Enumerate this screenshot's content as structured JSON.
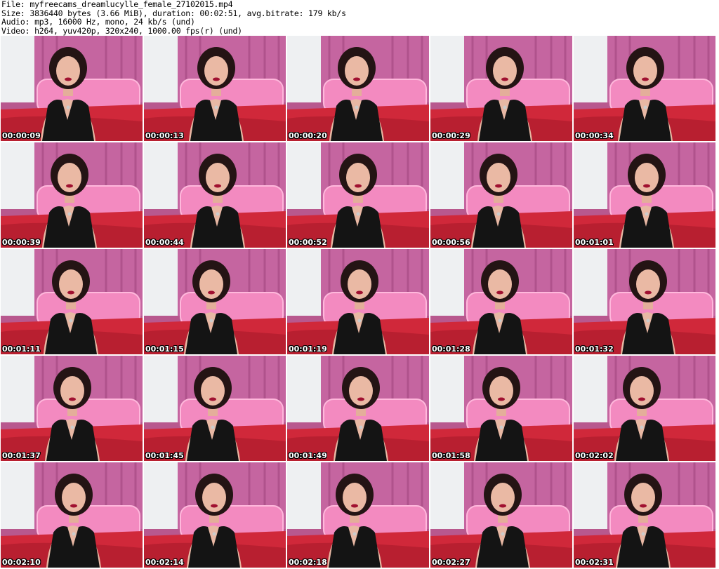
{
  "header": {
    "file_line": "File: myfreecams_dreamlucylle_female_27102015.mp4",
    "size_line": "Size: 3836440 bytes (3.66 MiB), duration: 00:02:51, avg.bitrate: 179 kb/s",
    "audio_line": "Audio: mp3, 16000 Hz, mono, 24 kb/s (und)",
    "video_line": "Video: h264, yuv420p, 320x240, 1000.00 fps(r) (und)"
  },
  "thumbnails": [
    {
      "timestamp": "00:00:09"
    },
    {
      "timestamp": "00:00:13"
    },
    {
      "timestamp": "00:00:20"
    },
    {
      "timestamp": "00:00:29"
    },
    {
      "timestamp": "00:00:34"
    },
    {
      "timestamp": "00:00:39"
    },
    {
      "timestamp": "00:00:44"
    },
    {
      "timestamp": "00:00:52"
    },
    {
      "timestamp": "00:00:56"
    },
    {
      "timestamp": "00:01:01"
    },
    {
      "timestamp": "00:01:11"
    },
    {
      "timestamp": "00:01:15"
    },
    {
      "timestamp": "00:01:19"
    },
    {
      "timestamp": "00:01:28"
    },
    {
      "timestamp": "00:01:32"
    },
    {
      "timestamp": "00:01:37"
    },
    {
      "timestamp": "00:01:45"
    },
    {
      "timestamp": "00:01:49"
    },
    {
      "timestamp": "00:01:58"
    },
    {
      "timestamp": "00:02:02"
    },
    {
      "timestamp": "00:02:10"
    },
    {
      "timestamp": "00:02:14"
    },
    {
      "timestamp": "00:02:18"
    },
    {
      "timestamp": "00:02:27"
    },
    {
      "timestamp": "00:02:31"
    }
  ]
}
